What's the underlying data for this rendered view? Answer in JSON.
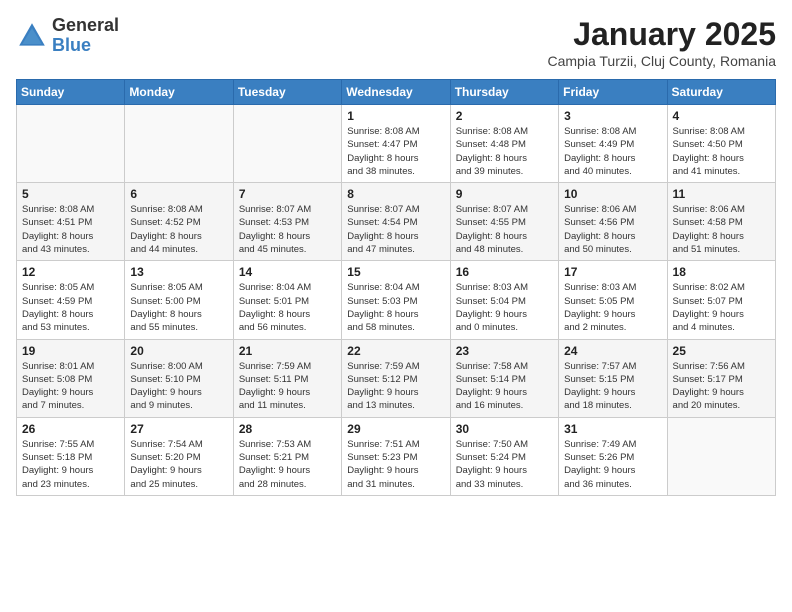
{
  "header": {
    "logo_general": "General",
    "logo_blue": "Blue",
    "month_title": "January 2025",
    "location": "Campia Turzii, Cluj County, Romania"
  },
  "weekdays": [
    "Sunday",
    "Monday",
    "Tuesday",
    "Wednesday",
    "Thursday",
    "Friday",
    "Saturday"
  ],
  "weeks": [
    [
      {
        "day": "",
        "info": ""
      },
      {
        "day": "",
        "info": ""
      },
      {
        "day": "",
        "info": ""
      },
      {
        "day": "1",
        "info": "Sunrise: 8:08 AM\nSunset: 4:47 PM\nDaylight: 8 hours\nand 38 minutes."
      },
      {
        "day": "2",
        "info": "Sunrise: 8:08 AM\nSunset: 4:48 PM\nDaylight: 8 hours\nand 39 minutes."
      },
      {
        "day": "3",
        "info": "Sunrise: 8:08 AM\nSunset: 4:49 PM\nDaylight: 8 hours\nand 40 minutes."
      },
      {
        "day": "4",
        "info": "Sunrise: 8:08 AM\nSunset: 4:50 PM\nDaylight: 8 hours\nand 41 minutes."
      }
    ],
    [
      {
        "day": "5",
        "info": "Sunrise: 8:08 AM\nSunset: 4:51 PM\nDaylight: 8 hours\nand 43 minutes."
      },
      {
        "day": "6",
        "info": "Sunrise: 8:08 AM\nSunset: 4:52 PM\nDaylight: 8 hours\nand 44 minutes."
      },
      {
        "day": "7",
        "info": "Sunrise: 8:07 AM\nSunset: 4:53 PM\nDaylight: 8 hours\nand 45 minutes."
      },
      {
        "day": "8",
        "info": "Sunrise: 8:07 AM\nSunset: 4:54 PM\nDaylight: 8 hours\nand 47 minutes."
      },
      {
        "day": "9",
        "info": "Sunrise: 8:07 AM\nSunset: 4:55 PM\nDaylight: 8 hours\nand 48 minutes."
      },
      {
        "day": "10",
        "info": "Sunrise: 8:06 AM\nSunset: 4:56 PM\nDaylight: 8 hours\nand 50 minutes."
      },
      {
        "day": "11",
        "info": "Sunrise: 8:06 AM\nSunset: 4:58 PM\nDaylight: 8 hours\nand 51 minutes."
      }
    ],
    [
      {
        "day": "12",
        "info": "Sunrise: 8:05 AM\nSunset: 4:59 PM\nDaylight: 8 hours\nand 53 minutes."
      },
      {
        "day": "13",
        "info": "Sunrise: 8:05 AM\nSunset: 5:00 PM\nDaylight: 8 hours\nand 55 minutes."
      },
      {
        "day": "14",
        "info": "Sunrise: 8:04 AM\nSunset: 5:01 PM\nDaylight: 8 hours\nand 56 minutes."
      },
      {
        "day": "15",
        "info": "Sunrise: 8:04 AM\nSunset: 5:03 PM\nDaylight: 8 hours\nand 58 minutes."
      },
      {
        "day": "16",
        "info": "Sunrise: 8:03 AM\nSunset: 5:04 PM\nDaylight: 9 hours\nand 0 minutes."
      },
      {
        "day": "17",
        "info": "Sunrise: 8:03 AM\nSunset: 5:05 PM\nDaylight: 9 hours\nand 2 minutes."
      },
      {
        "day": "18",
        "info": "Sunrise: 8:02 AM\nSunset: 5:07 PM\nDaylight: 9 hours\nand 4 minutes."
      }
    ],
    [
      {
        "day": "19",
        "info": "Sunrise: 8:01 AM\nSunset: 5:08 PM\nDaylight: 9 hours\nand 7 minutes."
      },
      {
        "day": "20",
        "info": "Sunrise: 8:00 AM\nSunset: 5:10 PM\nDaylight: 9 hours\nand 9 minutes."
      },
      {
        "day": "21",
        "info": "Sunrise: 7:59 AM\nSunset: 5:11 PM\nDaylight: 9 hours\nand 11 minutes."
      },
      {
        "day": "22",
        "info": "Sunrise: 7:59 AM\nSunset: 5:12 PM\nDaylight: 9 hours\nand 13 minutes."
      },
      {
        "day": "23",
        "info": "Sunrise: 7:58 AM\nSunset: 5:14 PM\nDaylight: 9 hours\nand 16 minutes."
      },
      {
        "day": "24",
        "info": "Sunrise: 7:57 AM\nSunset: 5:15 PM\nDaylight: 9 hours\nand 18 minutes."
      },
      {
        "day": "25",
        "info": "Sunrise: 7:56 AM\nSunset: 5:17 PM\nDaylight: 9 hours\nand 20 minutes."
      }
    ],
    [
      {
        "day": "26",
        "info": "Sunrise: 7:55 AM\nSunset: 5:18 PM\nDaylight: 9 hours\nand 23 minutes."
      },
      {
        "day": "27",
        "info": "Sunrise: 7:54 AM\nSunset: 5:20 PM\nDaylight: 9 hours\nand 25 minutes."
      },
      {
        "day": "28",
        "info": "Sunrise: 7:53 AM\nSunset: 5:21 PM\nDaylight: 9 hours\nand 28 minutes."
      },
      {
        "day": "29",
        "info": "Sunrise: 7:51 AM\nSunset: 5:23 PM\nDaylight: 9 hours\nand 31 minutes."
      },
      {
        "day": "30",
        "info": "Sunrise: 7:50 AM\nSunset: 5:24 PM\nDaylight: 9 hours\nand 33 minutes."
      },
      {
        "day": "31",
        "info": "Sunrise: 7:49 AM\nSunset: 5:26 PM\nDaylight: 9 hours\nand 36 minutes."
      },
      {
        "day": "",
        "info": ""
      }
    ]
  ]
}
